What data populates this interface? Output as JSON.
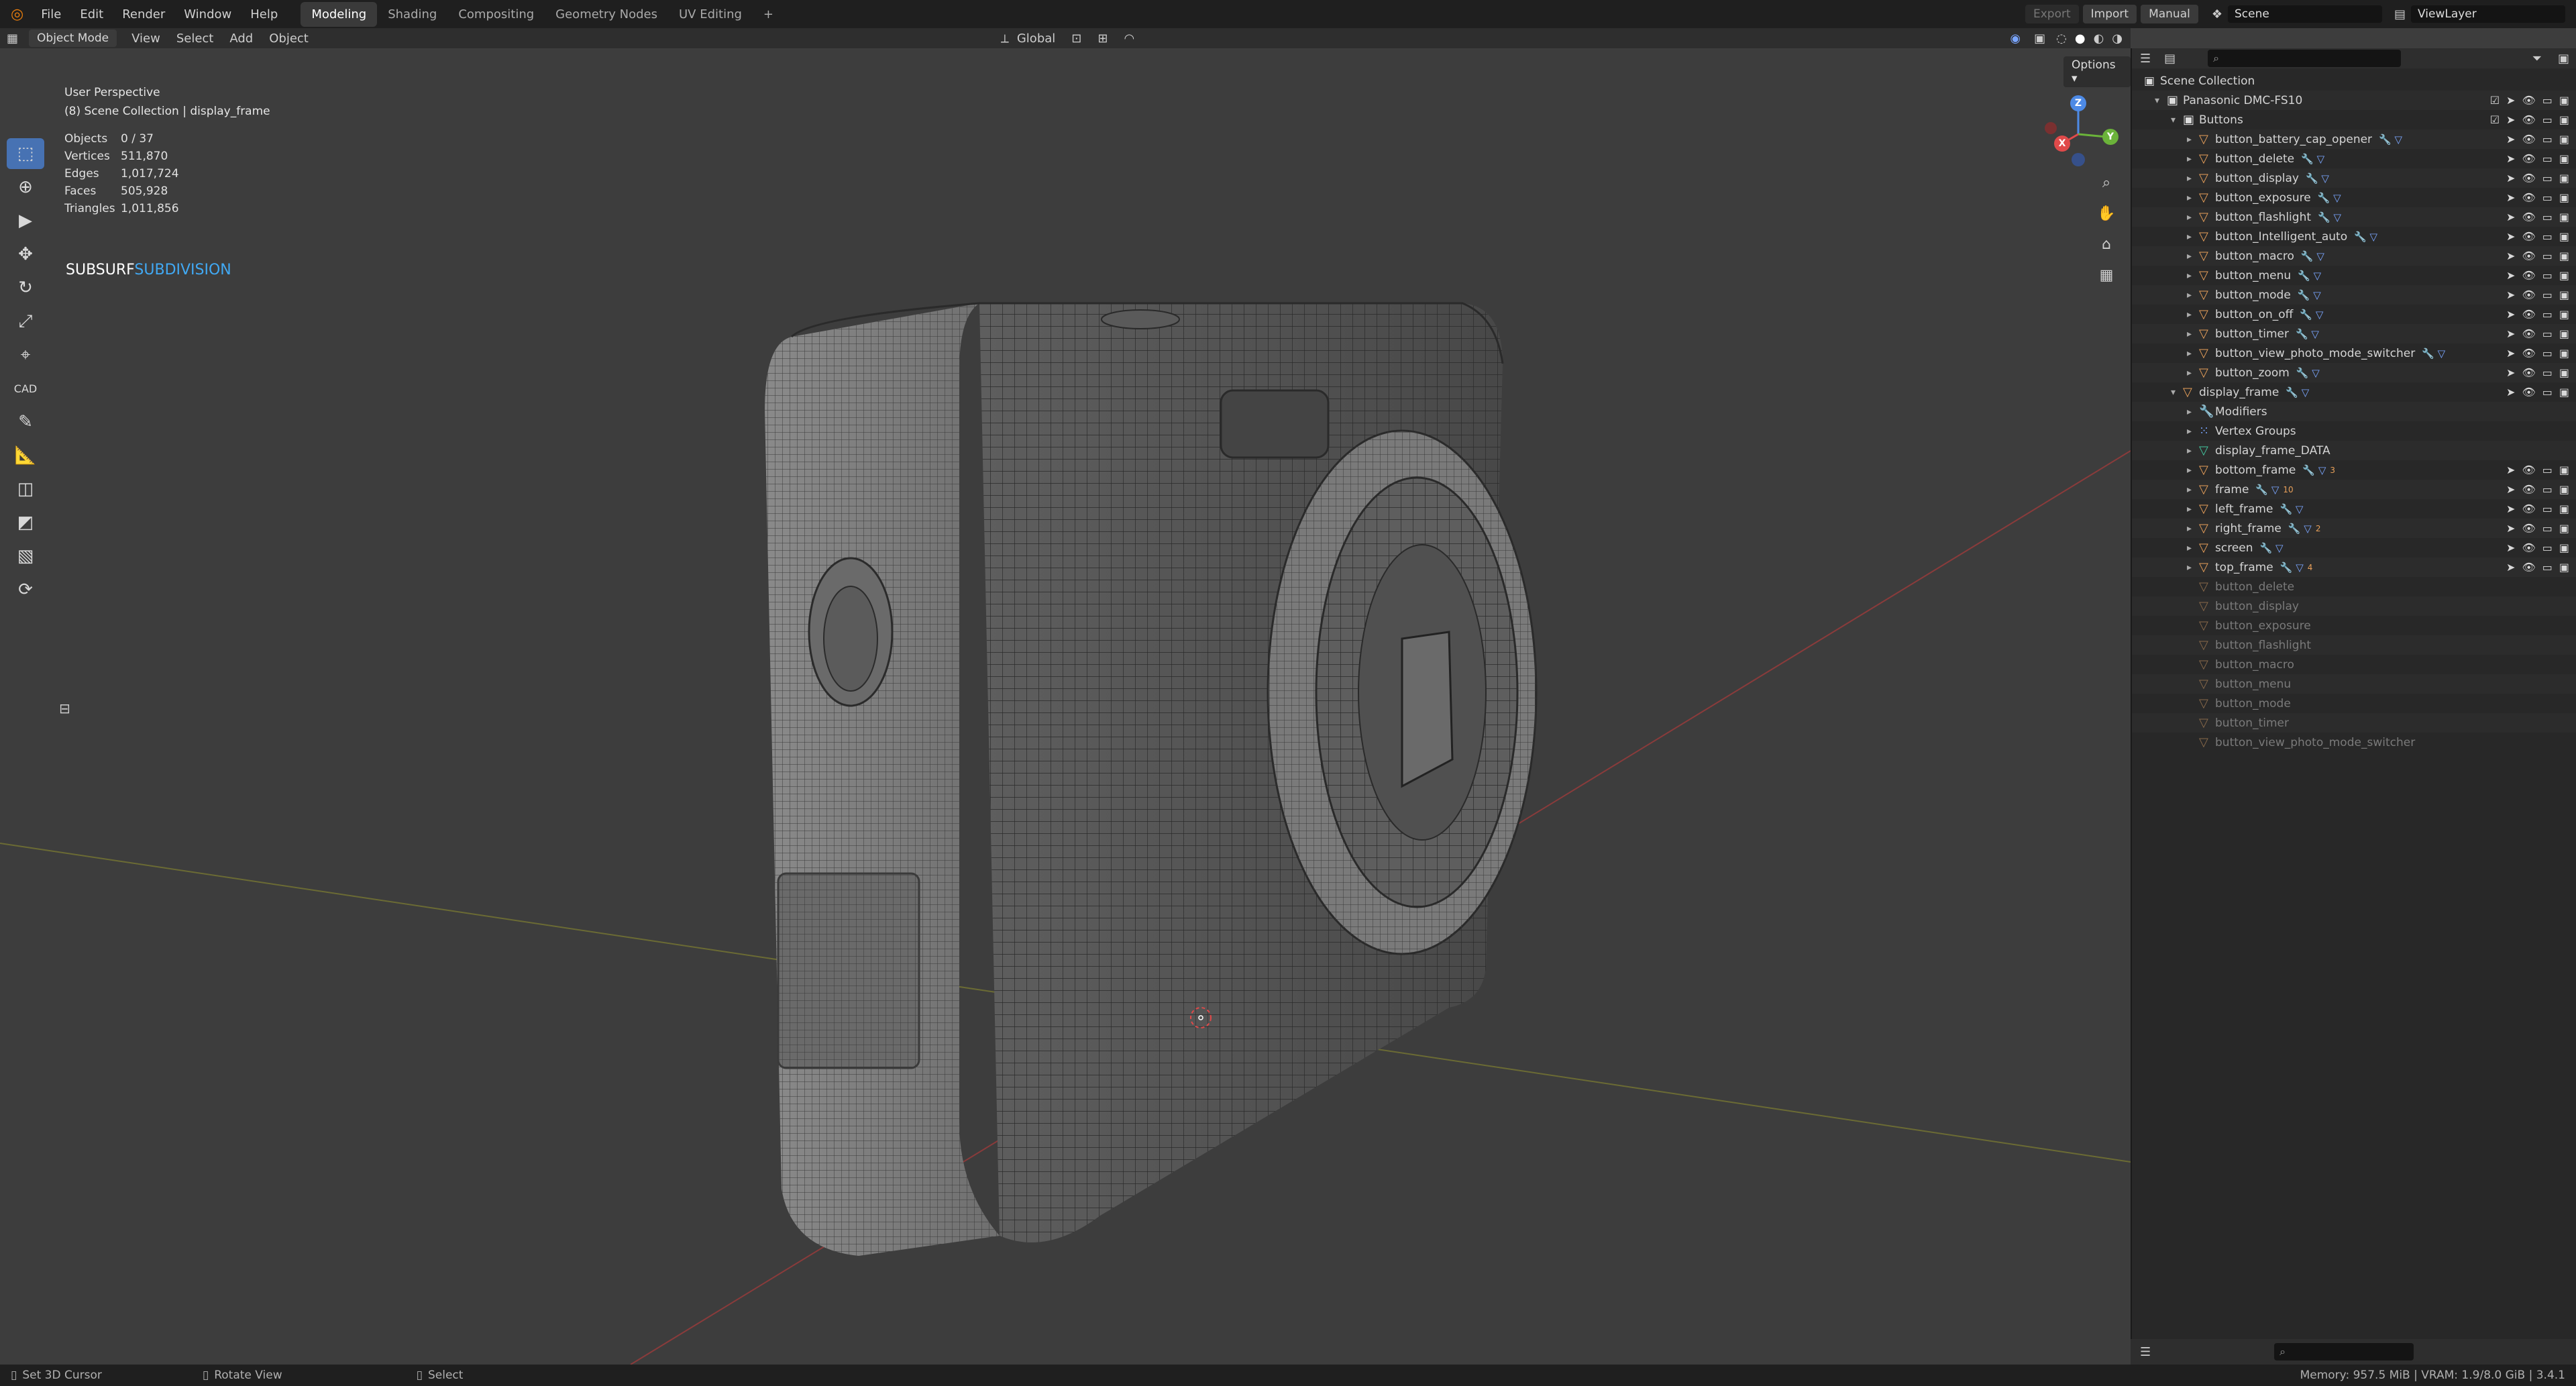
{
  "topbar": {
    "menus": [
      "File",
      "Edit",
      "Render",
      "Window",
      "Help"
    ],
    "workspaces": [
      {
        "label": "Modeling",
        "active": true
      },
      {
        "label": "Shading",
        "active": false
      },
      {
        "label": "Compositing",
        "active": false
      },
      {
        "label": "Geometry Nodes",
        "active": false
      },
      {
        "label": "UV Editing",
        "active": false
      }
    ],
    "add_tab": "+",
    "export_label": "Export",
    "import_label": "Import",
    "manual_label": "Manual",
    "scene_label": "Scene",
    "viewlayer_label": "ViewLayer"
  },
  "header": {
    "mode": "Object Mode",
    "menus": [
      "View",
      "Select",
      "Add",
      "Object"
    ],
    "orientation": "Global",
    "options_label": "Options"
  },
  "viewport": {
    "perspective": "User Perspective",
    "collection": "(8) Scene Collection | display_frame",
    "stats": [
      {
        "label": "Objects",
        "value": "0 / 37"
      },
      {
        "label": "Vertices",
        "value": "511,870"
      },
      {
        "label": "Edges",
        "value": "1,017,724"
      },
      {
        "label": "Faces",
        "value": "505,928"
      },
      {
        "label": "Triangles",
        "value": "1,011,856"
      }
    ],
    "addon_a": "SUBSURF",
    "addon_b": "SUBDIVISION",
    "gizmo": {
      "x": "X",
      "y": "Y",
      "z": "Z"
    }
  },
  "outliner": {
    "scene_collection": "Scene Collection",
    "rows": [
      {
        "label": "Panasonic DMC-FS10",
        "kind": "collection"
      },
      {
        "label": "Buttons",
        "kind": "collection"
      },
      {
        "label": "button_battery_cap_opener",
        "kind": "mesh"
      },
      {
        "label": "button_delete",
        "kind": "mesh"
      },
      {
        "label": "button_display",
        "kind": "mesh"
      },
      {
        "label": "button_exposure",
        "kind": "mesh"
      },
      {
        "label": "button_flashlight",
        "kind": "mesh"
      },
      {
        "label": "button_Intelligent_auto",
        "kind": "mesh"
      },
      {
        "label": "button_macro",
        "kind": "mesh"
      },
      {
        "label": "button_menu",
        "kind": "mesh"
      },
      {
        "label": "button_mode",
        "kind": "mesh"
      },
      {
        "label": "button_on_off",
        "kind": "mesh"
      },
      {
        "label": "button_timer",
        "kind": "mesh"
      },
      {
        "label": "button_view_photo_mode_switcher",
        "kind": "mesh"
      },
      {
        "label": "button_zoom",
        "kind": "mesh"
      },
      {
        "label": "display_frame",
        "kind": "mesh"
      },
      {
        "label": "Modifiers",
        "kind": "prop"
      },
      {
        "label": "Vertex Groups",
        "kind": "prop"
      },
      {
        "label": "display_frame_DATA",
        "kind": "prop"
      },
      {
        "label": "bottom_frame",
        "kind": "mesh",
        "badge": "3"
      },
      {
        "label": "frame",
        "kind": "mesh",
        "badge": "10"
      },
      {
        "label": "left_frame",
        "kind": "mesh"
      },
      {
        "label": "right_frame",
        "kind": "mesh",
        "badge": "2"
      },
      {
        "label": "screen",
        "kind": "mesh"
      },
      {
        "label": "top_frame",
        "kind": "mesh",
        "badge": "4"
      },
      {
        "label": "button_delete",
        "kind": "ghost"
      },
      {
        "label": "button_display",
        "kind": "ghost"
      },
      {
        "label": "button_exposure",
        "kind": "ghost"
      },
      {
        "label": "button_flashlight",
        "kind": "ghost"
      },
      {
        "label": "button_macro",
        "kind": "ghost"
      },
      {
        "label": "button_menu",
        "kind": "ghost"
      },
      {
        "label": "button_mode",
        "kind": "ghost"
      },
      {
        "label": "button_timer",
        "kind": "ghost"
      },
      {
        "label": "button_view_photo_mode_switcher",
        "kind": "ghost"
      }
    ]
  },
  "statusbar": {
    "hint1": "Set 3D Cursor",
    "hint2": "Rotate View",
    "hint3": "Select",
    "memory": "Memory: 957.5 MiB | VRAM: 1.9/8.0 GiB | 3.4.1"
  }
}
